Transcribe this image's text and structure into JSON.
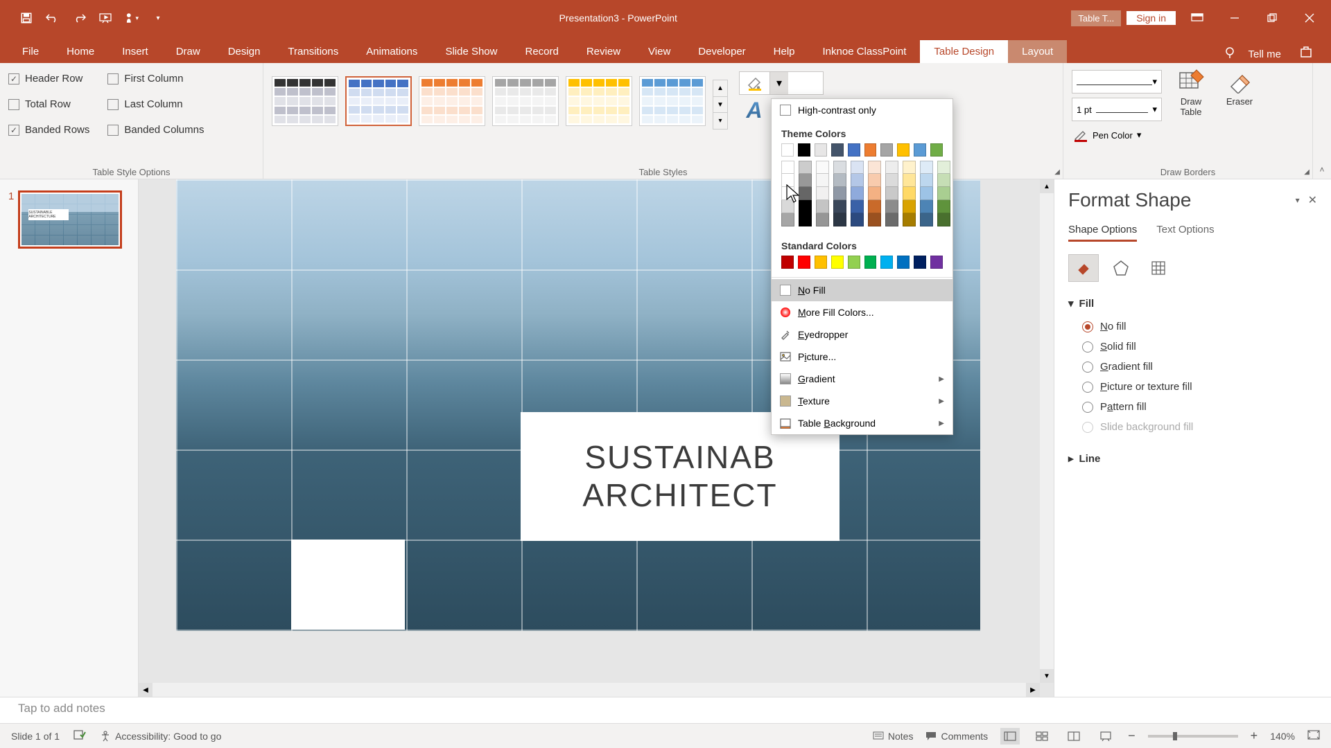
{
  "title": "Presentation3  -  PowerPoint",
  "title_context_tab": "Table T...",
  "signin": "Sign in",
  "ribbon_tabs": [
    "File",
    "Home",
    "Insert",
    "Draw",
    "Design",
    "Transitions",
    "Animations",
    "Slide Show",
    "Record",
    "Review",
    "View",
    "Developer",
    "Help",
    "Inknoe ClassPoint",
    "Table Design",
    "Layout"
  ],
  "tell_me": "Tell me",
  "table_style_options": {
    "header_row": "Header Row",
    "total_row": "Total Row",
    "banded_rows": "Banded Rows",
    "first_column": "First Column",
    "last_column": "Last Column",
    "banded_columns": "Banded Columns",
    "header_row_checked": true,
    "total_row_checked": false,
    "banded_rows_checked": true,
    "first_column_checked": false,
    "last_column_checked": false,
    "banded_columns_checked": false,
    "group_label": "Table Style Options"
  },
  "table_styles_label": "Table Styles",
  "draw_borders": {
    "pen_style": "———",
    "pen_weight": "1 pt",
    "pen_color": "Pen Color",
    "draw_table": "Draw\nTable",
    "eraser": "Eraser",
    "group_label": "Draw Borders"
  },
  "color_picker": {
    "high_contrast": "High-contrast only",
    "theme_header": "Theme Colors",
    "theme_row": [
      "#ffffff",
      "#000000",
      "#e7e6e6",
      "#44546a",
      "#4472c4",
      "#ed7d31",
      "#a5a5a5",
      "#ffc000",
      "#5b9bd5",
      "#70ad47"
    ],
    "standard_header": "Standard Colors",
    "standard": [
      "#c00000",
      "#ff0000",
      "#ffc000",
      "#ffff00",
      "#92d050",
      "#00b050",
      "#00b0f0",
      "#0070c0",
      "#002060",
      "#7030a0"
    ],
    "no_fill": "No Fill",
    "more": "More Fill Colors...",
    "eyedropper": "Eyedropper",
    "picture": "Picture...",
    "gradient": "Gradient",
    "texture": "Texture",
    "table_bg": "Table Background"
  },
  "format_shape": {
    "title": "Format Shape",
    "tabs": {
      "shape": "Shape Options",
      "text": "Text Options"
    },
    "fill": {
      "header": "Fill",
      "no_fill": "No fill",
      "solid": "Solid fill",
      "gradient": "Gradient fill",
      "picture": "Picture or texture fill",
      "pattern": "Pattern fill",
      "slide_bg": "Slide background fill"
    },
    "line": {
      "header": "Line"
    }
  },
  "thumb": {
    "num": "1",
    "label_text": "SUSTAINABLE ARCHITECTURE"
  },
  "slide_title": "SUSTAINAB\nARCHITECT",
  "notes_placeholder": "Tap to add notes",
  "status": {
    "slide": "Slide 1 of 1",
    "accessibility": "Accessibility: Good to go",
    "notes_btn": "Notes",
    "comments_btn": "Comments",
    "zoom": "140%"
  }
}
